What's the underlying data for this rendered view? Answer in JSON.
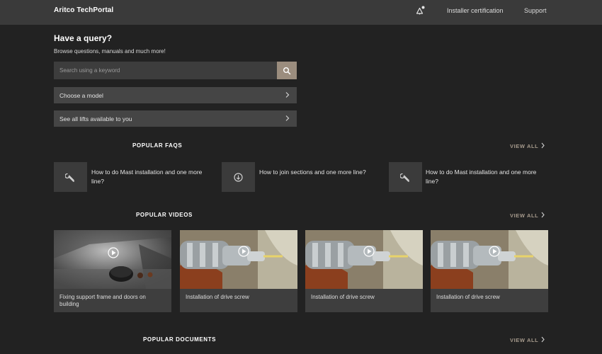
{
  "header": {
    "brand": "Aritco TechPortal",
    "nav": {
      "certification": "Installer certification",
      "support": "Support"
    },
    "icons": {
      "notification": "bell-icon"
    }
  },
  "query": {
    "title": "Have a query?",
    "subtitle": "Browse questions, manuals and much more!",
    "search_placeholder": "Search using a keyword",
    "choose_model": "Choose a model",
    "see_lifts": "See all lifts available to you"
  },
  "faqs": {
    "title": "POPULAR FAQS",
    "view_all": "VIEW ALL",
    "items": [
      {
        "icon": "wrench-icon",
        "text": "How to do Mast installation and one more line?"
      },
      {
        "icon": "circle-arrow-icon",
        "text": "How to join sections and one more line?"
      },
      {
        "icon": "wrench-icon",
        "text": "How to do Mast installation and one more line?"
      }
    ]
  },
  "videos": {
    "title": "POPULAR VIDEOS",
    "view_all": "VIEW ALL",
    "items": [
      {
        "label": "Fixing support frame and doors on building"
      },
      {
        "label": "Installation of drive screw"
      },
      {
        "label": "Installation of drive screw"
      },
      {
        "label": "Installation of drive screw"
      }
    ]
  },
  "documents": {
    "title": "POPULAR DOCUMENTS",
    "view_all": "VIEW ALL"
  },
  "colors": {
    "accent": "#9b8d7e",
    "view_all": "#a69a8c",
    "background": "#222222",
    "header": "#3a3a3a"
  }
}
